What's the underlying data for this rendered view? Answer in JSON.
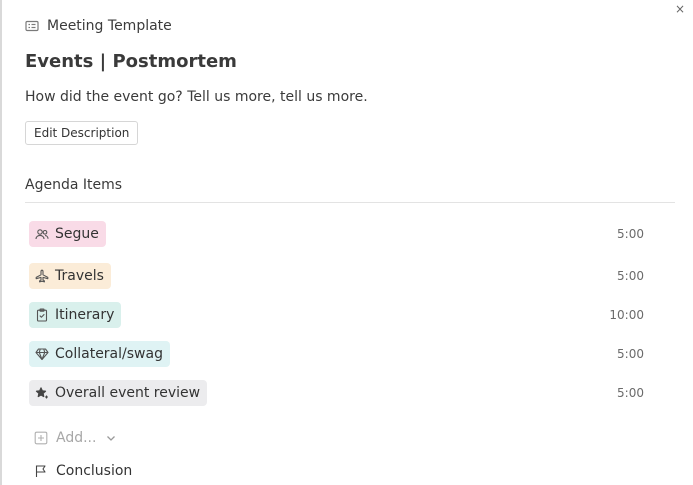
{
  "header": {
    "label": "Meeting Template",
    "icon": "template-card-icon"
  },
  "title": "Events | Postmortem",
  "description": "How did the event go? Tell us more, tell us more.",
  "edit_button": "Edit Description",
  "close_icon": "×",
  "agenda": {
    "section_title": "Agenda Items",
    "items": [
      {
        "label": "Segue",
        "duration": "5:00",
        "icon": "people-icon",
        "color": "#f9dbe7"
      },
      {
        "label": "Travels",
        "duration": "5:00",
        "icon": "airplane-icon",
        "color": "#fbecd8"
      },
      {
        "label": "Itinerary",
        "duration": "10:00",
        "icon": "clipboard-check-icon",
        "color": "#d9f0ec"
      },
      {
        "label": "Collateral/swag",
        "duration": "5:00",
        "icon": "gem-icon",
        "color": "#dff3f4"
      },
      {
        "label": "Overall event review",
        "duration": "5:00",
        "icon": "star-sparkle-icon",
        "color": "#ececee"
      }
    ],
    "add_label": "Add...",
    "conclusion_label": "Conclusion"
  }
}
